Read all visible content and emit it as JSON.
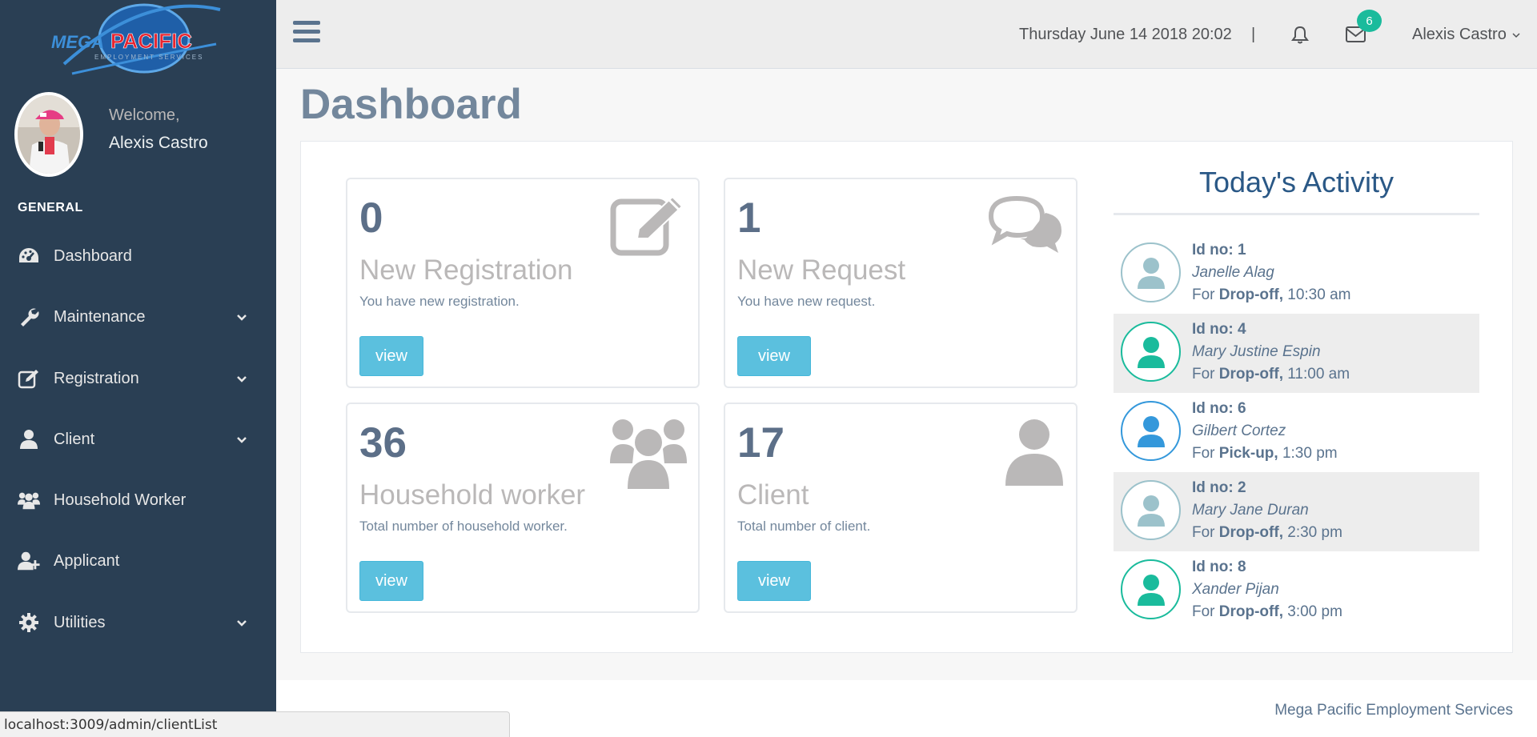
{
  "app": {
    "logo_text_mega": "MEGA",
    "logo_text_pacific": "PACIFIC",
    "logo_subtitle": "EMPLOYMENT SERVICES"
  },
  "sidebar": {
    "welcome": "Welcome,",
    "user_name": "Alexis Castro",
    "section_title": "GENERAL",
    "items": [
      {
        "label": "Dashboard",
        "icon": "dashboard-gauge-icon",
        "has_submenu": false
      },
      {
        "label": "Maintenance",
        "icon": "wrench-icon",
        "has_submenu": true
      },
      {
        "label": "Registration",
        "icon": "edit-icon",
        "has_submenu": true
      },
      {
        "label": "Client",
        "icon": "user-icon",
        "has_submenu": true
      },
      {
        "label": "Household Worker",
        "icon": "users-icon",
        "has_submenu": false
      },
      {
        "label": "Applicant",
        "icon": "user-plus-icon",
        "has_submenu": false
      },
      {
        "label": "Utilities",
        "icon": "gear-icon",
        "has_submenu": true
      }
    ]
  },
  "topbar": {
    "datetime": "Thursday June 14 2018 20:02",
    "separator": "|",
    "mail_badge": "6",
    "user_menu": "Alexis Castro"
  },
  "main": {
    "page_title": "Dashboard",
    "tiles": [
      {
        "count": "0",
        "title": "New Registration",
        "desc": "You have new registration.",
        "button": "view",
        "icon": "pencil-square-icon"
      },
      {
        "count": "1",
        "title": "New Request",
        "desc": "You have new request.",
        "button": "view",
        "icon": "comments-icon"
      },
      {
        "count": "36",
        "title": "Household worker",
        "desc": "Total number of household worker.",
        "button": "view",
        "icon": "users-icon"
      },
      {
        "count": "17",
        "title": "Client",
        "desc": "Total number of client.",
        "button": "view",
        "icon": "user-icon"
      }
    ],
    "activity": {
      "title": "Today's Activity",
      "items": [
        {
          "id": "Id no: 1",
          "name": "Janelle Alag",
          "for_prefix": "For ",
          "type": "Drop-off,",
          "time": " 10:30 am",
          "color": "#9CC2CB"
        },
        {
          "id": "Id no: 4",
          "name": "Mary Justine Espin",
          "for_prefix": "For ",
          "type": "Drop-off,",
          "time": " 11:00 am",
          "color": "#1ABB9C"
        },
        {
          "id": "Id no: 6",
          "name": "Gilbert Cortez",
          "for_prefix": "For ",
          "type": "Pick-up,",
          "time": " 1:30 pm",
          "color": "#3498DB"
        },
        {
          "id": "Id no: 2",
          "name": "Mary Jane Duran",
          "for_prefix": "For ",
          "type": "Drop-off,",
          "time": " 2:30 pm",
          "color": "#9CC2CB"
        },
        {
          "id": "Id no: 8",
          "name": "Xander Pijan",
          "for_prefix": "For ",
          "type": "Drop-off,",
          "time": " 3:00 pm",
          "color": "#1ABB9C"
        }
      ]
    }
  },
  "footer": {
    "text": "Mega Pacific Employment Services"
  },
  "status_bar": {
    "url": "localhost:3009/admin/clientList"
  },
  "colors": {
    "sidebar_bg": "#2A3F54",
    "accent_green": "#1ABB9C",
    "view_button": "#5BC0DE",
    "title_blue": "#2A5886"
  }
}
